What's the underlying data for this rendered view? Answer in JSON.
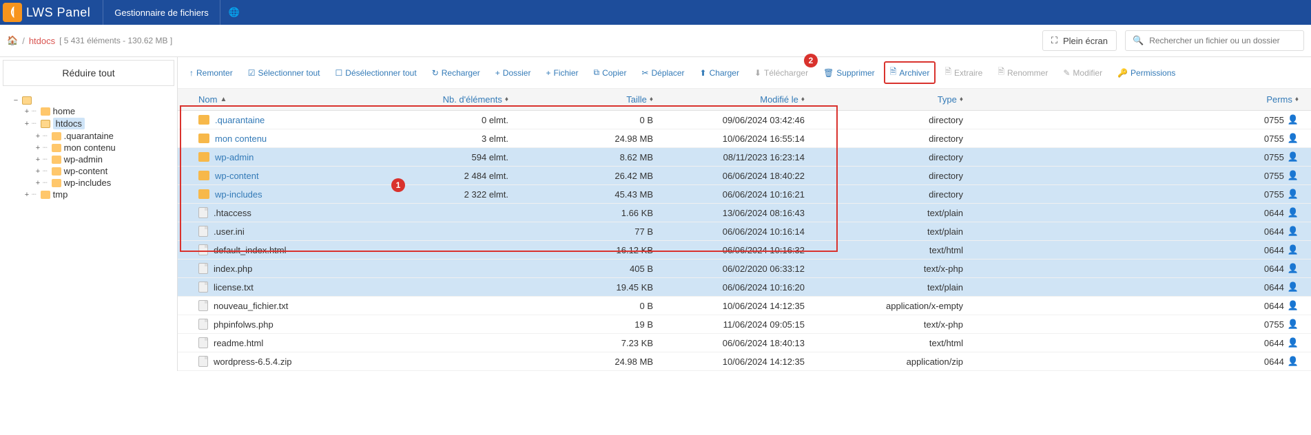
{
  "header": {
    "logo_symbol": "⟬",
    "logo_text": "LWS Panel",
    "title": "Gestionnaire de fichiers"
  },
  "breadcrumb": {
    "current": "htdocs",
    "meta": "[ 5 431 éléments - 130.62 MB ]"
  },
  "fullscreen_label": "Plein écran",
  "search": {
    "placeholder": "Rechercher un fichier ou un dossier"
  },
  "sidebar": {
    "collapse_all": "Réduire tout",
    "root_label": " ",
    "nodes": [
      {
        "label": "home",
        "level": 1,
        "expandable": true
      },
      {
        "label": "htdocs",
        "level": 1,
        "expandable": true,
        "selected": true
      },
      {
        "label": ".quarantaine",
        "level": 2,
        "expandable": true
      },
      {
        "label": "mon contenu",
        "level": 2,
        "expandable": true
      },
      {
        "label": "wp-admin",
        "level": 2,
        "expandable": true
      },
      {
        "label": "wp-content",
        "level": 2,
        "expandable": true
      },
      {
        "label": "wp-includes",
        "level": 2,
        "expandable": true
      },
      {
        "label": "tmp",
        "level": 1,
        "expandable": true
      }
    ]
  },
  "toolbar": [
    {
      "label": "Remonter",
      "icon": "↑",
      "enabled": true
    },
    {
      "label": "Sélectionner tout",
      "icon": "☑",
      "enabled": true
    },
    {
      "label": "Désélectionner tout",
      "icon": "☐",
      "enabled": true
    },
    {
      "label": "Recharger",
      "icon": "↻",
      "enabled": true
    },
    {
      "label": "Dossier",
      "icon": "+",
      "enabled": true
    },
    {
      "label": "Fichier",
      "icon": "+",
      "enabled": true
    },
    {
      "label": "Copier",
      "icon": "⧉",
      "enabled": true
    },
    {
      "label": "Déplacer",
      "icon": "✂",
      "enabled": true
    },
    {
      "label": "Charger",
      "icon": "⬆",
      "enabled": true
    },
    {
      "label": "Télécharger",
      "icon": "⬇",
      "enabled": false
    },
    {
      "label": "Supprimer",
      "icon": "🗑",
      "enabled": true
    },
    {
      "label": "Archiver",
      "icon": "🗎",
      "enabled": true,
      "highlighted": true
    },
    {
      "label": "Extraire",
      "icon": "🗎",
      "enabled": false
    },
    {
      "label": "Renommer",
      "icon": "🗎",
      "enabled": false
    },
    {
      "label": "Modifier",
      "icon": "✎",
      "enabled": false
    },
    {
      "label": "Permissions",
      "icon": "🔑",
      "enabled": true
    }
  ],
  "columns": {
    "name": "Nom",
    "elements": "Nb. d'éléments",
    "size": "Taille",
    "modified": "Modifié le",
    "type": "Type",
    "perms": "Perms"
  },
  "rows": [
    {
      "name": ".quarantaine",
      "kind": "folder",
      "link": true,
      "elements": "0 elmt.",
      "size": "0 B",
      "modified": "09/06/2024 03:42:46",
      "type": "directory",
      "perms": "0755",
      "selected": false
    },
    {
      "name": "mon contenu",
      "kind": "folder",
      "link": true,
      "elements": "3 elmt.",
      "size": "24.98 MB",
      "modified": "10/06/2024 16:55:14",
      "type": "directory",
      "perms": "0755",
      "selected": false
    },
    {
      "name": "wp-admin",
      "kind": "folder",
      "link": true,
      "elements": "594 elmt.",
      "size": "8.62 MB",
      "modified": "08/11/2023 16:23:14",
      "type": "directory",
      "perms": "0755",
      "selected": true
    },
    {
      "name": "wp-content",
      "kind": "folder",
      "link": true,
      "elements": "2 484 elmt.",
      "size": "26.42 MB",
      "modified": "06/06/2024 18:40:22",
      "type": "directory",
      "perms": "0755",
      "selected": true
    },
    {
      "name": "wp-includes",
      "kind": "folder",
      "link": true,
      "elements": "2 322 elmt.",
      "size": "45.43 MB",
      "modified": "06/06/2024 10:16:21",
      "type": "directory",
      "perms": "0755",
      "selected": true
    },
    {
      "name": ".htaccess",
      "kind": "file",
      "link": false,
      "elements": "",
      "size": "1.66 KB",
      "modified": "13/06/2024 08:16:43",
      "type": "text/plain",
      "perms": "0644",
      "selected": true
    },
    {
      "name": ".user.ini",
      "kind": "file",
      "link": false,
      "elements": "",
      "size": "77 B",
      "modified": "06/06/2024 10:16:14",
      "type": "text/plain",
      "perms": "0644",
      "selected": true
    },
    {
      "name": "default_index.html",
      "kind": "file",
      "link": false,
      "elements": "",
      "size": "16.12 KB",
      "modified": "06/06/2024 10:16:32",
      "type": "text/html",
      "perms": "0644",
      "selected": true
    },
    {
      "name": "index.php",
      "kind": "file",
      "link": false,
      "elements": "",
      "size": "405 B",
      "modified": "06/02/2020 06:33:12",
      "type": "text/x-php",
      "perms": "0644",
      "selected": true
    },
    {
      "name": "license.txt",
      "kind": "file",
      "link": false,
      "elements": "",
      "size": "19.45 KB",
      "modified": "06/06/2024 10:16:20",
      "type": "text/plain",
      "perms": "0644",
      "selected": true
    },
    {
      "name": "nouveau_fichier.txt",
      "kind": "file",
      "link": false,
      "elements": "",
      "size": "0 B",
      "modified": "10/06/2024 14:12:35",
      "type": "application/x-empty",
      "perms": "0644",
      "selected": false
    },
    {
      "name": "phpinfolws.php",
      "kind": "file",
      "link": false,
      "elements": "",
      "size": "19 B",
      "modified": "11/06/2024 09:05:15",
      "type": "text/x-php",
      "perms": "0755",
      "selected": false
    },
    {
      "name": "readme.html",
      "kind": "file",
      "link": false,
      "elements": "",
      "size": "7.23 KB",
      "modified": "06/06/2024 18:40:13",
      "type": "text/html",
      "perms": "0644",
      "selected": false
    },
    {
      "name": "wordpress-6.5.4.zip",
      "kind": "file",
      "link": false,
      "elements": "",
      "size": "24.98 MB",
      "modified": "10/06/2024 14:12:35",
      "type": "application/zip",
      "perms": "0644",
      "selected": false
    }
  ],
  "annotations": {
    "badge1": "1",
    "badge2": "2"
  }
}
